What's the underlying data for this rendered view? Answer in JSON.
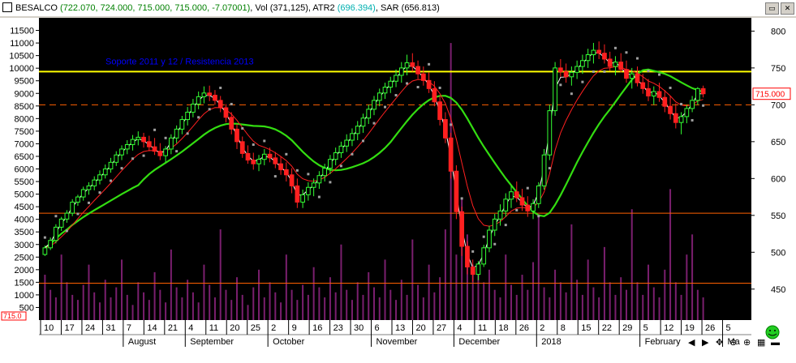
{
  "window": {
    "symbol": "BESALCO",
    "quote_values": "(722.070, 724.000, 715.000, 715.000, -7.07001)",
    "vol_label": "Vol",
    "vol_value": "(371,125)",
    "atr_label": "ATR2",
    "atr_value": "(696.394)",
    "sar_label": "SAR",
    "sar_value": "(656.813)",
    "buttons": [
      "restore-icon",
      "close-icon"
    ]
  },
  "chart_data": {
    "type": "candlestick",
    "annotation": "Soporte 2011 y 12 / Resistencia 2013",
    "price_axis": {
      "ticks": [
        450,
        500,
        550,
        600,
        650,
        700,
        750,
        800
      ],
      "range": [
        408,
        818
      ]
    },
    "volume_axis": {
      "ticks": [
        500,
        1000,
        1500,
        2000,
        2500,
        3000,
        3500,
        4000,
        4500,
        5000,
        5500,
        6000,
        6500,
        7000,
        7500,
        8000,
        8500,
        9000,
        9500,
        10000,
        10500,
        11000,
        11500
      ],
      "range": [
        0,
        12000
      ]
    },
    "last_price_label": "715.000",
    "left_marker_label": "715.0",
    "x_ticks": [
      "10",
      "17",
      "24",
      "31",
      "7",
      "14",
      "21",
      "4",
      "11",
      "20",
      "25",
      "2",
      "9",
      "16",
      "23",
      "30",
      "6",
      "13",
      "20",
      "27",
      "4",
      "11",
      "18",
      "26",
      "2",
      "8",
      "15",
      "22",
      "29",
      "5",
      "12",
      "19",
      "26",
      "5"
    ],
    "months": [
      "August",
      "September",
      "October",
      "November",
      "December",
      "2018",
      "February",
      "Ma"
    ],
    "horizontal_levels": [
      {
        "price": 745,
        "style": "solid",
        "color": "#ffff00"
      },
      {
        "price": 700,
        "style": "dashed",
        "color": "#ff6000"
      },
      {
        "price": 553,
        "style": "solid",
        "color": "#ff6000"
      },
      {
        "price": 458,
        "style": "solid",
        "color": "#ff6000"
      }
    ],
    "candles": [
      [
        497,
        509,
        495,
        506
      ],
      [
        506,
        520,
        503,
        516
      ],
      [
        516,
        538,
        512,
        534
      ],
      [
        534,
        548,
        529,
        545
      ],
      [
        545,
        557,
        540,
        553
      ],
      [
        553,
        572,
        549,
        568
      ],
      [
        568,
        578,
        563,
        575
      ],
      [
        575,
        589,
        570,
        585
      ],
      [
        585,
        595,
        578,
        590
      ],
      [
        590,
        603,
        584,
        598
      ],
      [
        598,
        611,
        592,
        605
      ],
      [
        605,
        619,
        600,
        613
      ],
      [
        613,
        628,
        608,
        622
      ],
      [
        622,
        637,
        617,
        632
      ],
      [
        632,
        645,
        625,
        640
      ],
      [
        640,
        652,
        633,
        646
      ],
      [
        646,
        659,
        638,
        653
      ],
      [
        653,
        664,
        645,
        656
      ],
      [
        656,
        662,
        642,
        650
      ],
      [
        650,
        658,
        637,
        643
      ],
      [
        643,
        655,
        632,
        637
      ],
      [
        637,
        648,
        625,
        631
      ],
      [
        631,
        644,
        622,
        640
      ],
      [
        640,
        660,
        633,
        655
      ],
      [
        655,
        672,
        648,
        667
      ],
      [
        667,
        685,
        660,
        680
      ],
      [
        680,
        697,
        672,
        690
      ],
      [
        690,
        708,
        683,
        701
      ],
      [
        701,
        718,
        694,
        711
      ],
      [
        711,
        725,
        702,
        716
      ],
      [
        716,
        726,
        705,
        713
      ],
      [
        713,
        720,
        700,
        706
      ],
      [
        706,
        712,
        690,
        696
      ],
      [
        696,
        701,
        676,
        683
      ],
      [
        683,
        690,
        660,
        667
      ],
      [
        667,
        674,
        640,
        650
      ],
      [
        650,
        657,
        628,
        634
      ],
      [
        634,
        645,
        620,
        625
      ],
      [
        625,
        635,
        612,
        620
      ],
      [
        620,
        632,
        610,
        626
      ],
      [
        626,
        640,
        618,
        633
      ],
      [
        633,
        642,
        622,
        628
      ],
      [
        628,
        636,
        614,
        620
      ],
      [
        620,
        630,
        605,
        612
      ],
      [
        612,
        622,
        596,
        605
      ],
      [
        605,
        614,
        580,
        590
      ],
      [
        590,
        600,
        560,
        568
      ],
      [
        568,
        585,
        560,
        578
      ],
      [
        578,
        595,
        570,
        588
      ],
      [
        588,
        600,
        576,
        594
      ],
      [
        594,
        610,
        586,
        604
      ],
      [
        604,
        620,
        596,
        614
      ],
      [
        614,
        632,
        606,
        626
      ],
      [
        626,
        642,
        618,
        635
      ],
      [
        635,
        650,
        628,
        644
      ],
      [
        644,
        660,
        636,
        652
      ],
      [
        652,
        668,
        644,
        661
      ],
      [
        661,
        678,
        652,
        671
      ],
      [
        671,
        688,
        662,
        682
      ],
      [
        682,
        700,
        674,
        694
      ],
      [
        694,
        712,
        686,
        706
      ],
      [
        706,
        722,
        698,
        716
      ],
      [
        716,
        730,
        708,
        724
      ],
      [
        724,
        738,
        716,
        732
      ],
      [
        732,
        748,
        724,
        740
      ],
      [
        740,
        758,
        730,
        750
      ],
      [
        750,
        768,
        740,
        757
      ],
      [
        757,
        770,
        745,
        752
      ],
      [
        752,
        760,
        735,
        742
      ],
      [
        742,
        752,
        726,
        733
      ],
      [
        733,
        744,
        716,
        722
      ],
      [
        722,
        732,
        698,
        704
      ],
      [
        704,
        712,
        672,
        680
      ],
      [
        680,
        690,
        648,
        655
      ],
      [
        655,
        662,
        600,
        610
      ],
      [
        610,
        618,
        545,
        555
      ],
      [
        555,
        562,
        495,
        508
      ],
      [
        508,
        515,
        470,
        480
      ],
      [
        480,
        490,
        460,
        470
      ],
      [
        470,
        488,
        462,
        484
      ],
      [
        484,
        510,
        480,
        506
      ],
      [
        506,
        536,
        500,
        530
      ],
      [
        530,
        552,
        522,
        545
      ],
      [
        545,
        565,
        536,
        556
      ],
      [
        556,
        580,
        548,
        572
      ],
      [
        572,
        590,
        560,
        582
      ],
      [
        582,
        596,
        568,
        574
      ],
      [
        574,
        586,
        556,
        564
      ],
      [
        564,
        576,
        548,
        556
      ],
      [
        556,
        572,
        545,
        566
      ],
      [
        566,
        595,
        560,
        590
      ],
      [
        590,
        640,
        585,
        632
      ],
      [
        632,
        700,
        625,
        692
      ],
      [
        692,
        758,
        685,
        750
      ],
      [
        750,
        762,
        738,
        745
      ],
      [
        745,
        756,
        730,
        738
      ],
      [
        738,
        752,
        726,
        744
      ],
      [
        744,
        760,
        735,
        752
      ],
      [
        752,
        768,
        742,
        760
      ],
      [
        760,
        776,
        750,
        768
      ],
      [
        768,
        784,
        756,
        774
      ],
      [
        774,
        786,
        762,
        770
      ],
      [
        770,
        782,
        756,
        762
      ],
      [
        762,
        772,
        746,
        752
      ],
      [
        752,
        766,
        740,
        758
      ],
      [
        758,
        770,
        744,
        748
      ],
      [
        748,
        760,
        730,
        736
      ],
      [
        736,
        750,
        722,
        742
      ],
      [
        742,
        752,
        725,
        730
      ],
      [
        730,
        742,
        715,
        722
      ],
      [
        722,
        735,
        705,
        712
      ],
      [
        712,
        725,
        700,
        718
      ],
      [
        718,
        730,
        704,
        710
      ],
      [
        710,
        720,
        690,
        698
      ],
      [
        698,
        712,
        680,
        688
      ],
      [
        688,
        702,
        668,
        676
      ],
      [
        676,
        690,
        660,
        684
      ],
      [
        684,
        700,
        675,
        695
      ],
      [
        695,
        712,
        690,
        706
      ],
      [
        706,
        724,
        700,
        722
      ],
      [
        722,
        726,
        710,
        715
      ]
    ],
    "volume": [
      1800,
      1200,
      900,
      2600,
      1500,
      1000,
      800,
      1400,
      2200,
      1100,
      700,
      1600,
      900,
      1300,
      2400,
      1000,
      600,
      1500,
      1100,
      800,
      1900,
      1200,
      700,
      2800,
      1300,
      900,
      1600,
      1100,
      700,
      2200,
      1400,
      900,
      3600,
      1200,
      800,
      1700,
      1000,
      600,
      1300,
      2000,
      900,
      1500,
      1100,
      700,
      2600,
      1200,
      800,
      1400,
      1000,
      2100,
      1300,
      900,
      1700,
      1100,
      3000,
      1200,
      800,
      1500,
      1000,
      1900,
      1300,
      900,
      2400,
      1200,
      800,
      1600,
      1000,
      3200,
      1400,
      900,
      2200,
      1100,
      1700,
      3600,
      11000,
      2600,
      4800,
      3400,
      2200,
      1800,
      1500,
      2000,
      1200,
      900,
      2600,
      1400,
      1000,
      1800,
      1200,
      2300,
      4200,
      1300,
      900,
      2000,
      1500,
      1100,
      3800,
      1600,
      1000,
      2400,
      1300,
      900,
      2900,
      1500,
      1000,
      1700,
      1200,
      4400,
      1500,
      1000,
      2200,
      1300,
      900,
      2000,
      5200,
      1500,
      1000,
      2600,
      3400,
      1200,
      900
    ]
  }
}
